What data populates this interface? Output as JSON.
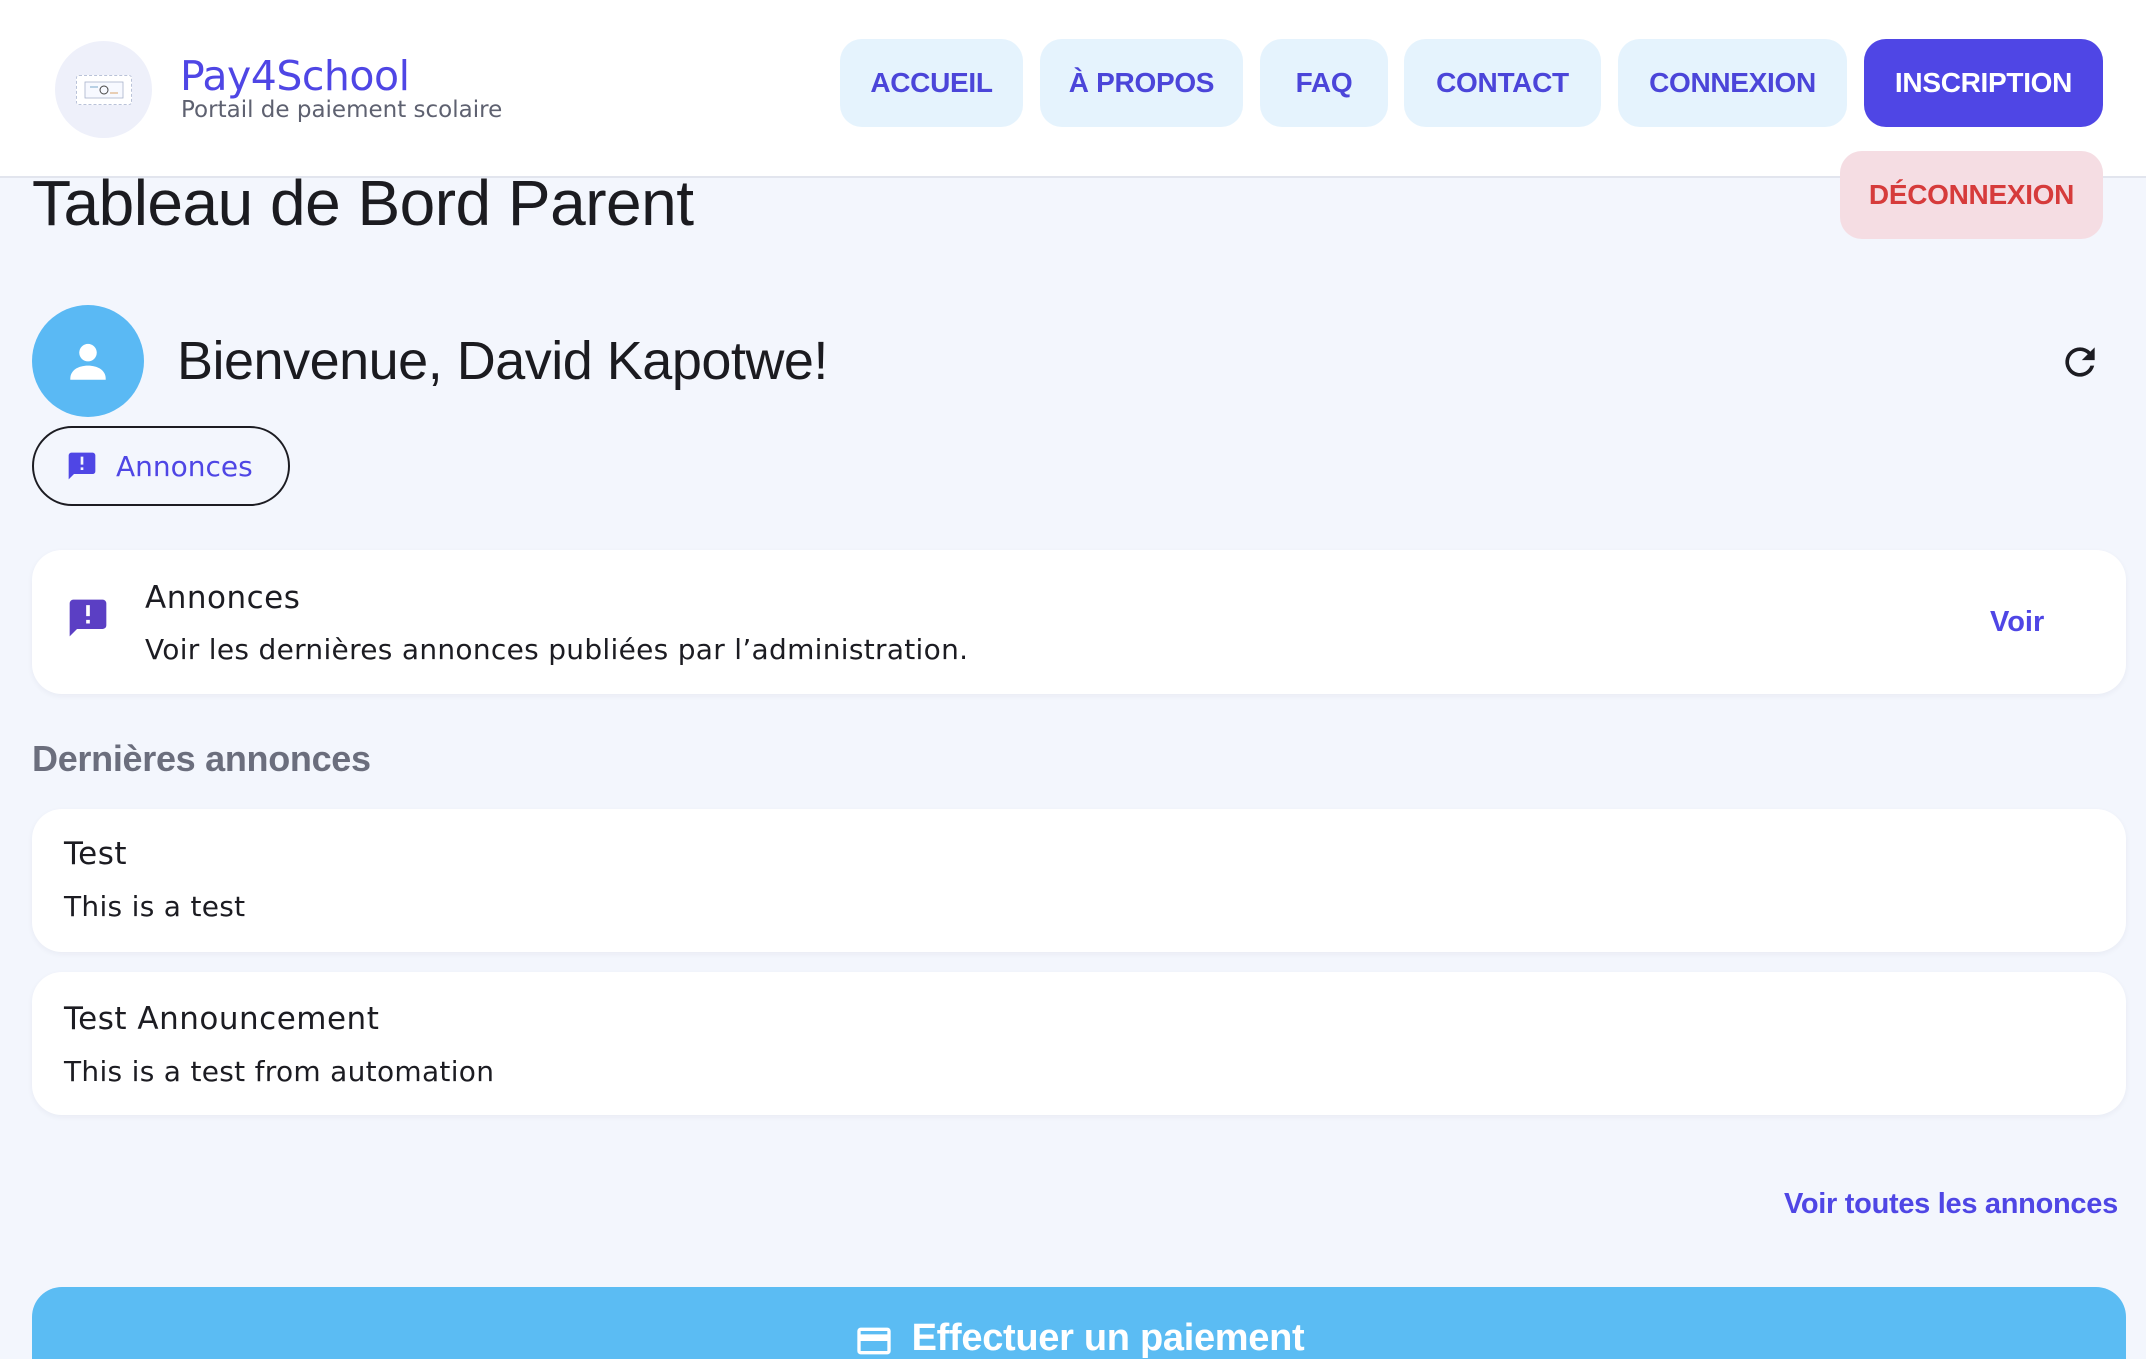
{
  "header": {
    "brand_name": "Pay4School",
    "brand_tagline": "Portail de paiement scolaire",
    "nav": [
      {
        "label": "ACCUEIL"
      },
      {
        "label": "À PROPOS"
      },
      {
        "label": "FAQ"
      },
      {
        "label": "CONTACT"
      },
      {
        "label": "CONNEXION"
      },
      {
        "label": "INSCRIPTION"
      }
    ],
    "logout_label": "DÉCONNEXION"
  },
  "page": {
    "title": "Tableau de Bord Parent",
    "welcome": "Bienvenue, David Kapotwe!",
    "chip_label": "Annonces"
  },
  "summary_card": {
    "title": "Annonces",
    "text": "Voir les dernières annonces publiées par l’administration.",
    "action": "Voir"
  },
  "latest": {
    "section_title": "Dernières annonces",
    "items": [
      {
        "title": "Test",
        "body": "This is a test"
      },
      {
        "title": "Test Announcement",
        "body": "This is a test from automation"
      }
    ],
    "see_all": "Voir toutes les annonces"
  },
  "payment": {
    "label": "Effectuer un paiement"
  },
  "colors": {
    "accent": "#4f46e5",
    "nav_bg": "#e5f3fd",
    "avatar": "#5ab9f4",
    "logout_text": "#d63b3b",
    "logout_bg": "#f5dde3",
    "announce_icon": "#5b3fc4"
  },
  "icons": {
    "user": "person-icon",
    "refresh": "refresh-icon",
    "announcement": "announcement-icon",
    "card": "credit-card-icon"
  }
}
